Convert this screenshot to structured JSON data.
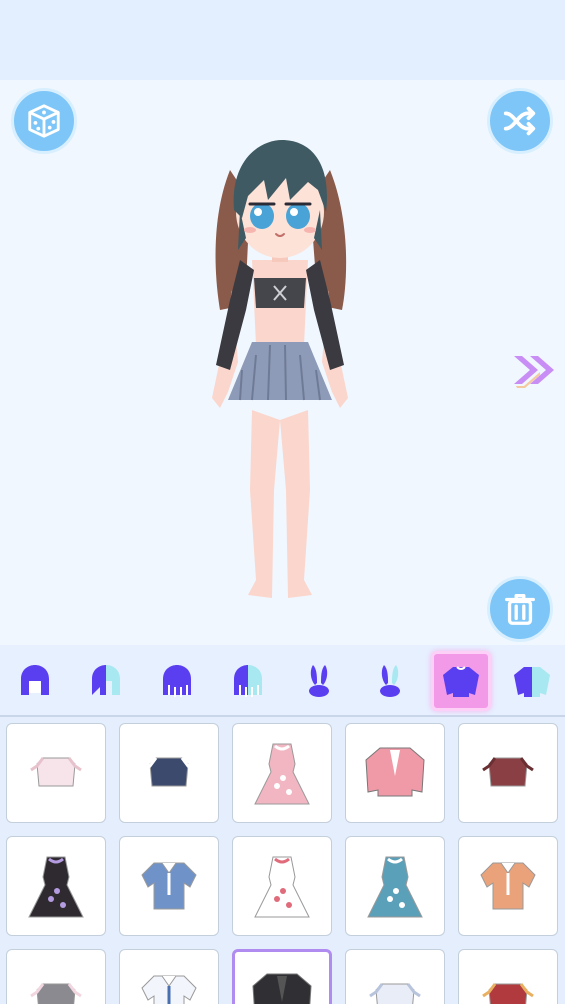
{
  "toolbar": {
    "random_icon": "dice-icon",
    "shuffle_icon": "shuffle-icon",
    "trash_icon": "trash-icon",
    "next_icon": "double-chevron-right-icon"
  },
  "colors": {
    "accent": "#7ec6f7",
    "tab_icon": "#5a3ff0",
    "tab_active": "#f29ae8",
    "selection_border": "#b18cf0"
  },
  "tabs": [
    {
      "id": "hair-front",
      "icon": "hair-front-icon",
      "active": false
    },
    {
      "id": "hair-front-color",
      "icon": "hair-front-color-icon",
      "active": false
    },
    {
      "id": "hair-back",
      "icon": "hair-back-icon",
      "active": false
    },
    {
      "id": "hair-back-color",
      "icon": "hair-back-color-icon",
      "active": false
    },
    {
      "id": "ears",
      "icon": "bunny-ears-icon",
      "active": false
    },
    {
      "id": "ears-color",
      "icon": "bunny-ears-color-icon",
      "active": false
    },
    {
      "id": "tops",
      "icon": "sweater-icon",
      "active": true
    },
    {
      "id": "tops-color",
      "icon": "sweater-color-icon",
      "active": false
    }
  ],
  "items": [
    {
      "name": "white-bralette",
      "icon": "top-icon",
      "selected": false
    },
    {
      "name": "navy-sailor-top",
      "icon": "top-icon",
      "selected": false
    },
    {
      "name": "pink-maid-dress",
      "icon": "dress-icon",
      "selected": false
    },
    {
      "name": "pink-open-jacket",
      "icon": "jacket-icon",
      "selected": false
    },
    {
      "name": "maroon-bell-sleeve-top",
      "icon": "top-icon",
      "selected": false
    },
    {
      "name": "purple-overall-dress",
      "icon": "dress-icon",
      "selected": false
    },
    {
      "name": "blue-collared-shirt",
      "icon": "shirt-icon",
      "selected": false
    },
    {
      "name": "white-polka-dot-dress",
      "icon": "dress-icon",
      "selected": false
    },
    {
      "name": "teal-pinafore-dress",
      "icon": "dress-icon",
      "selected": false
    },
    {
      "name": "orange-vest-shirt",
      "icon": "shirt-icon",
      "selected": false
    },
    {
      "name": "grey-crop-tee",
      "icon": "top-icon",
      "selected": false
    },
    {
      "name": "white-tie-shirt",
      "icon": "shirt-icon",
      "selected": false
    },
    {
      "name": "black-jacket-crop-top",
      "icon": "jacket-icon",
      "selected": true
    },
    {
      "name": "white-halter-top",
      "icon": "top-icon",
      "selected": false
    },
    {
      "name": "red-off-shoulder-tee",
      "icon": "top-icon",
      "selected": false
    }
  ]
}
